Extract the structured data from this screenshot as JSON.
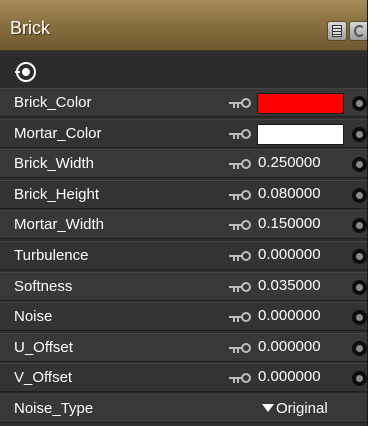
{
  "panel": {
    "title": "Brick",
    "list_icon": "list-icon",
    "spin_icon": "refresh-icon",
    "node_icon": "node-output-icon"
  },
  "properties": [
    {
      "name": "Brick_Color",
      "kind": "color",
      "color": "#ff0000"
    },
    {
      "name": "Mortar_Color",
      "kind": "color",
      "color": "#ffffff"
    },
    {
      "name": "Brick_Width",
      "kind": "number",
      "value": "0.250000"
    },
    {
      "name": "Brick_Height",
      "kind": "number",
      "value": "0.080000"
    },
    {
      "name": "Mortar_Width",
      "kind": "number",
      "value": "0.150000"
    },
    {
      "name": "Turbulence",
      "kind": "number",
      "value": "0.000000"
    },
    {
      "name": "Softness",
      "kind": "number",
      "value": "0.035000"
    },
    {
      "name": "Noise",
      "kind": "number",
      "value": "0.000000"
    },
    {
      "name": "U_Offset",
      "kind": "number",
      "value": "0.000000"
    },
    {
      "name": "V_Offset",
      "kind": "number",
      "value": "0.000000"
    },
    {
      "name": "Noise_Type",
      "kind": "dropdown",
      "value": "Original"
    }
  ]
}
